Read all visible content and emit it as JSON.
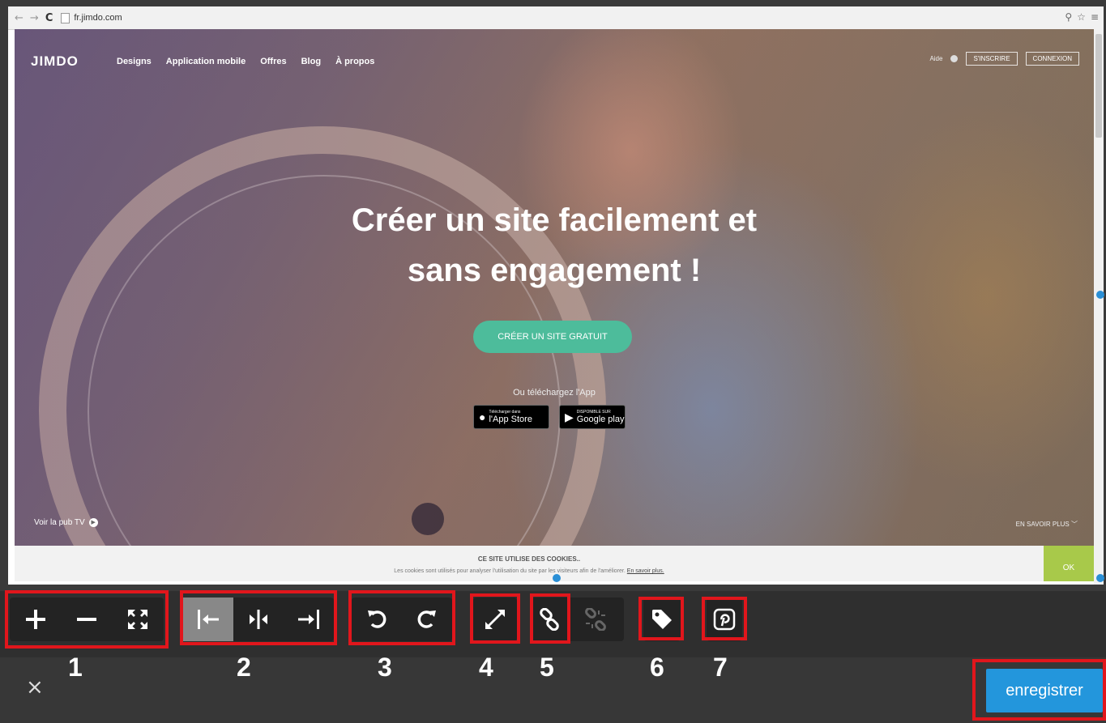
{
  "browser": {
    "nav_back": "←",
    "nav_forward": "→",
    "nav_reload": "C",
    "url": "fr.jimdo.com",
    "search_glyph": "⚲",
    "star_glyph": "☆",
    "menu_glyph": "≡"
  },
  "site": {
    "logo": "JIMDO",
    "menu": [
      "Designs",
      "Application mobile",
      "Offres",
      "Blog",
      "À propos"
    ],
    "help": "Aide",
    "signup": "S'INSCRIRE",
    "login": "CONNEXION",
    "headline_line1": "Créer un site facilement et",
    "headline_line2": "sans engagement !",
    "cta": "CRÉER UN SITE GRATUIT",
    "app_label": "Ou téléchargez l'App",
    "appstore_small": "Télécharger dans",
    "appstore_big": "l'App Store",
    "googleplay_small": "DISPONIBLE SUR",
    "googleplay_big": "Google play",
    "pub_tv": "Voir la pub TV",
    "learn_more": "EN SAVOIR PLUS",
    "learn_more_arrow": "﹀"
  },
  "cookie": {
    "title": "CE SITE UTILISE DES COOKIES..",
    "text": "Les cookies sont utilisés pour analyser l'utilisation du site par les visiteurs afin de l'améliorer.",
    "link": "En savoir plus.",
    "ok": "OK"
  },
  "toolbar": {
    "groups": [
      {
        "number": "1",
        "tools": [
          "zoom-in",
          "zoom-out",
          "fit-to-screen"
        ]
      },
      {
        "number": "2",
        "tools": [
          "align-left",
          "align-center",
          "align-right"
        ]
      },
      {
        "number": "3",
        "tools": [
          "rotate-left",
          "rotate-right"
        ]
      },
      {
        "number": "4",
        "tools": [
          "resize"
        ]
      },
      {
        "number": "5",
        "tools": [
          "link",
          "unlink"
        ]
      },
      {
        "number": "6",
        "tools": [
          "tag"
        ]
      },
      {
        "number": "7",
        "tools": [
          "pinterest"
        ]
      }
    ],
    "active_tool": "align-left",
    "disabled_tool": "unlink"
  },
  "footer": {
    "close": "×",
    "save": "enregistrer"
  },
  "colors": {
    "highlight": "#e1161c",
    "save_button": "#2396dc",
    "cta": "#4dbc9b",
    "cookie_ok": "#a8c94a",
    "handles": "#2a8fd6"
  }
}
